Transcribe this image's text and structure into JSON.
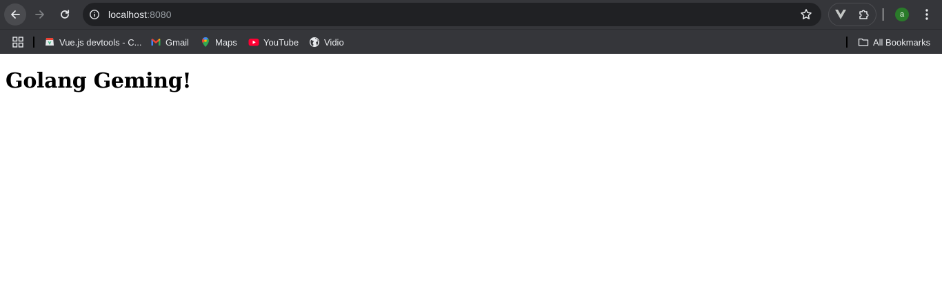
{
  "toolbar": {
    "url_host": "localhost",
    "url_port": ":8080",
    "avatar_letter": "a",
    "icons": {
      "back": "arrow-left-icon",
      "forward": "arrow-right-icon",
      "reload": "reload-icon",
      "site_info": "info-icon",
      "bookmark": "star-icon",
      "vue_ext": "vue-devtools-icon",
      "extensions": "puzzle-icon",
      "menu": "kebab-menu-icon"
    }
  },
  "bookmarks": {
    "items": [
      {
        "label": "Vue.js devtools - C...",
        "icon": "vue-devtools-favicon"
      },
      {
        "label": "Gmail",
        "icon": "gmail-favicon"
      },
      {
        "label": "Maps",
        "icon": "maps-favicon"
      },
      {
        "label": "YouTube",
        "icon": "youtube-favicon"
      },
      {
        "label": "Vidio",
        "icon": "globe-favicon"
      }
    ],
    "all_label": "All Bookmarks"
  },
  "page": {
    "heading": "Golang Geming!"
  },
  "colors": {
    "chrome_bg": "#35363a",
    "omnibox_bg": "#202124",
    "text": "#e8eaed",
    "muted": "#9aa0a6",
    "avatar": "#2a7a2a"
  }
}
